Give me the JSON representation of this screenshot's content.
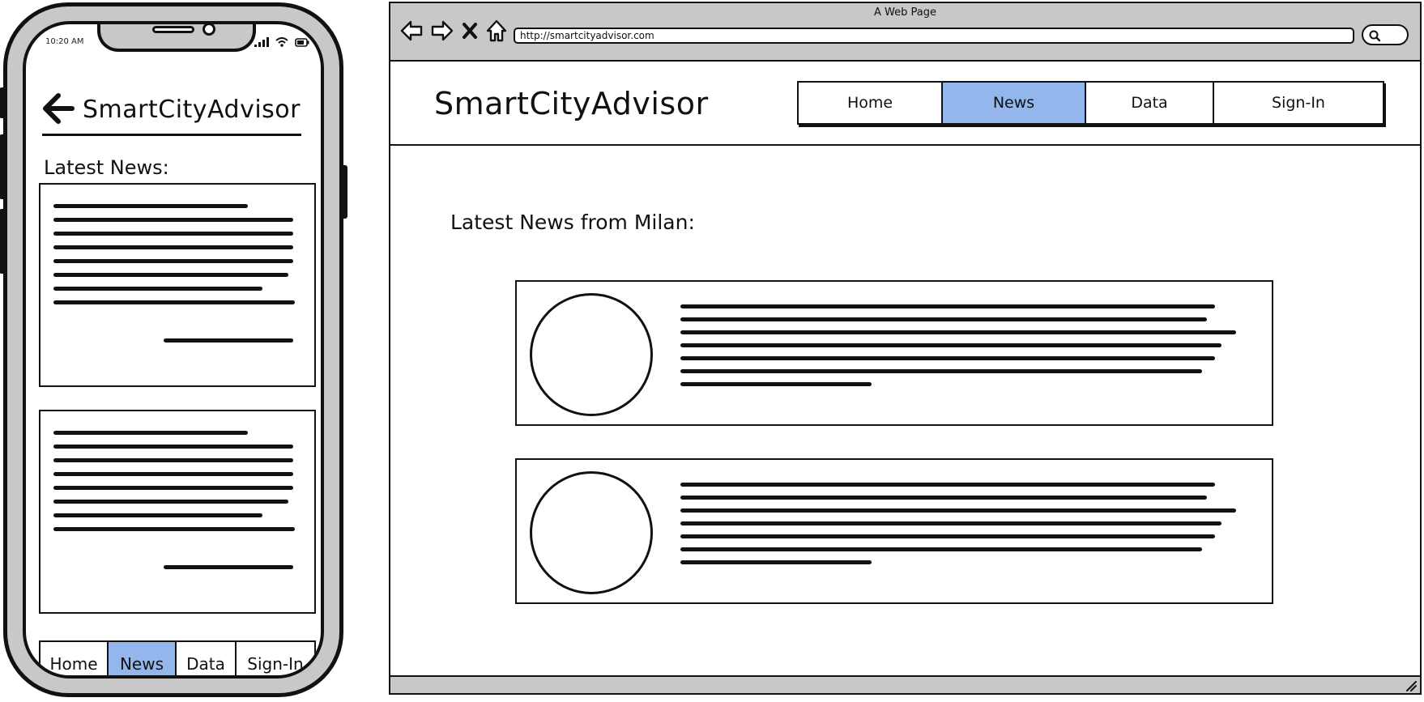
{
  "phone": {
    "time": "10:20 AM",
    "app_title": "SmartCityAdvisor",
    "section_title": "Latest News:",
    "nav_tabs": [
      {
        "label": "Home",
        "active": false
      },
      {
        "label": "News",
        "active": true
      },
      {
        "label": "Data",
        "active": false
      },
      {
        "label": "Sign-In",
        "active": false
      }
    ]
  },
  "browser": {
    "window_title": "A Web Page",
    "url": "http://smartcityadvisor.com",
    "site_title": "SmartCityAdvisor",
    "section_title": "Latest News from Milan:",
    "nav_tabs": [
      {
        "label": "Home",
        "active": false
      },
      {
        "label": "News",
        "active": true
      },
      {
        "label": "Data",
        "active": false
      },
      {
        "label": "Sign-In",
        "active": false
      }
    ]
  },
  "colors": {
    "active_tab": "#93b7ec",
    "chrome_gray": "#c8c8c8",
    "ink": "#111111"
  },
  "icons": {
    "back": "arrow-left-icon",
    "forward": "arrow-right-icon",
    "stop": "close-icon",
    "home": "home-icon",
    "search": "search-icon",
    "signal": "signal-icon",
    "wifi": "wifi-icon",
    "battery": "battery-icon",
    "resize": "resize-grip-icon"
  }
}
